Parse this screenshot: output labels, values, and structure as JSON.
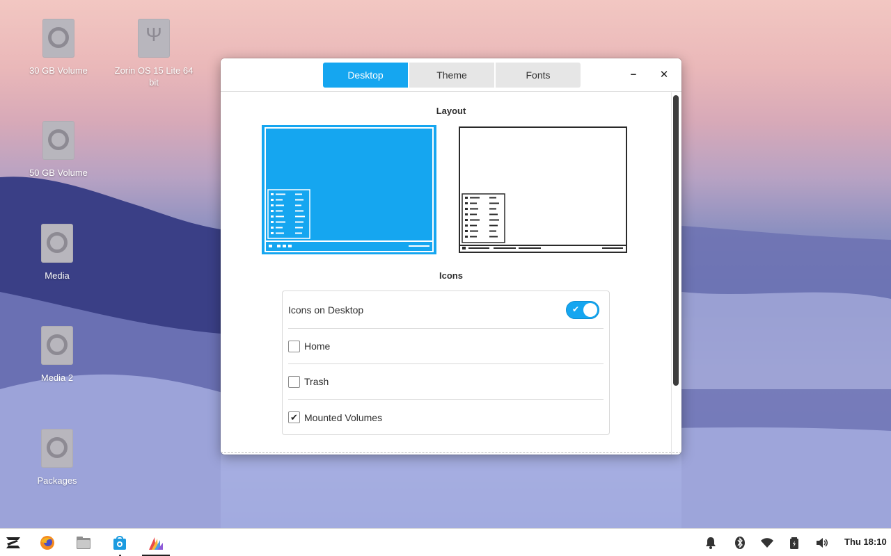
{
  "desktop": {
    "icons": [
      {
        "label": "30 GB Volume",
        "icon": "drive-icon"
      },
      {
        "label": "Zorin OS 15 Lite 64 bit",
        "icon": "usb-drive-icon"
      },
      {
        "label": "50 GB Volume",
        "icon": "drive-icon"
      },
      {
        "label": "Media",
        "icon": "drive-icon"
      },
      {
        "label": "Media 2",
        "icon": "drive-icon"
      },
      {
        "label": "Packages",
        "icon": "drive-icon"
      }
    ]
  },
  "window": {
    "tabs": [
      {
        "label": "Desktop",
        "active": true
      },
      {
        "label": "Theme",
        "active": false
      },
      {
        "label": "Fonts",
        "active": false
      }
    ],
    "minimize_glyph": "−",
    "close_glyph": "✕",
    "layout_title": "Layout",
    "icons_title": "Icons",
    "icons_on_desktop": {
      "label": "Icons on Desktop",
      "enabled": true
    },
    "options": [
      {
        "label": "Home",
        "checked": false
      },
      {
        "label": "Trash",
        "checked": false
      },
      {
        "label": "Mounted Volumes",
        "checked": true
      }
    ],
    "accent": "#15a6f0"
  },
  "taskbar": {
    "apps": [
      "zorin-menu-icon",
      "firefox-icon",
      "files-icon",
      "software-store-icon",
      "appearance-icon"
    ],
    "tray": [
      "bell-icon",
      "bluetooth-icon",
      "wifi-icon",
      "battery-icon",
      "volume-icon"
    ],
    "clock": "Thu 18:10"
  }
}
